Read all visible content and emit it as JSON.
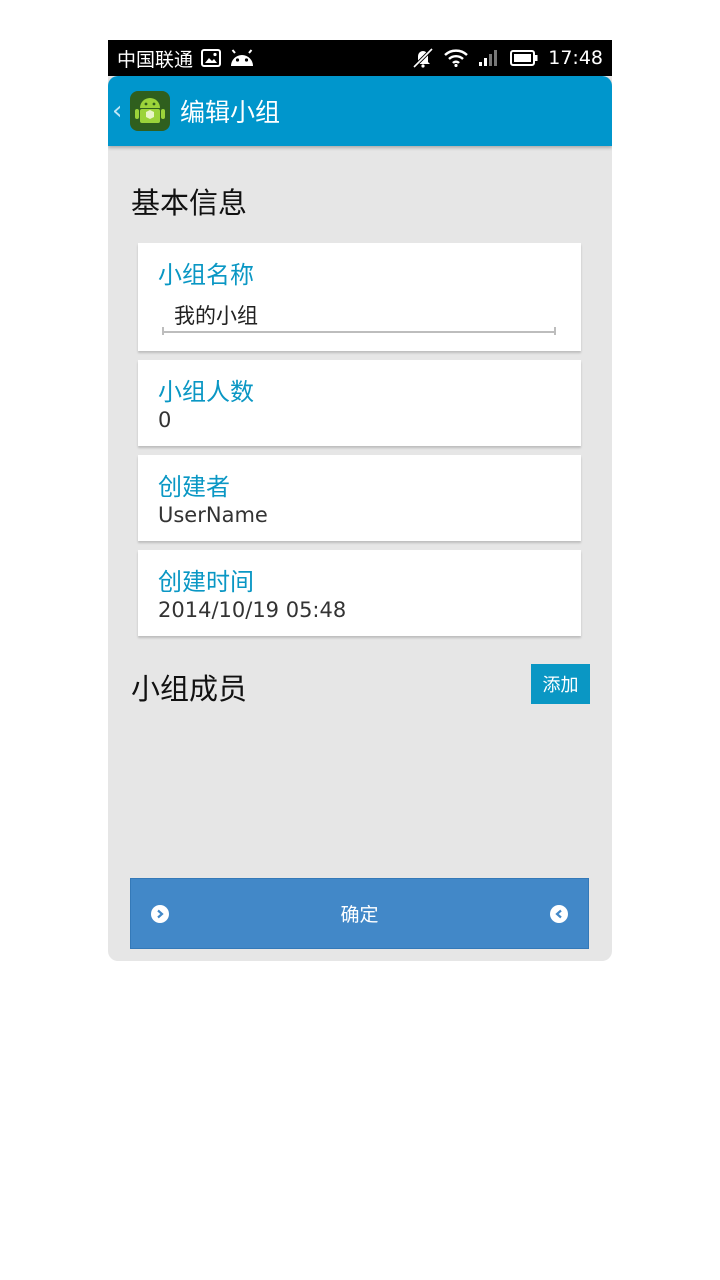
{
  "status_bar": {
    "carrier": "中国联通",
    "time": "17:48",
    "icons": [
      "image-icon",
      "android-icon",
      "mute-icon",
      "wifi-icon",
      "signal-icon",
      "battery-icon"
    ]
  },
  "app_bar": {
    "title": "编辑小组",
    "back_icon": "chevron-left-icon",
    "logo_icon": "android-robot-icon"
  },
  "basic_info": {
    "title": "基本信息",
    "fields": [
      {
        "label": "小组名称",
        "value": "我的小组",
        "editable": true
      },
      {
        "label": "小组人数",
        "value": "0"
      },
      {
        "label": "创建者",
        "value": "UserName"
      },
      {
        "label": "创建时间",
        "value": "2014/10/19 05:48"
      }
    ]
  },
  "members": {
    "title": "小组成员",
    "add_label": "添加"
  },
  "confirm": {
    "label": "确定",
    "left_icon": "circle-chevron-right-icon",
    "right_icon": "circle-chevron-left-icon"
  },
  "colors": {
    "accent": "#0096cc",
    "label": "#0a97c4",
    "confirm": "#4288c8",
    "background": "#e6e6e6"
  }
}
